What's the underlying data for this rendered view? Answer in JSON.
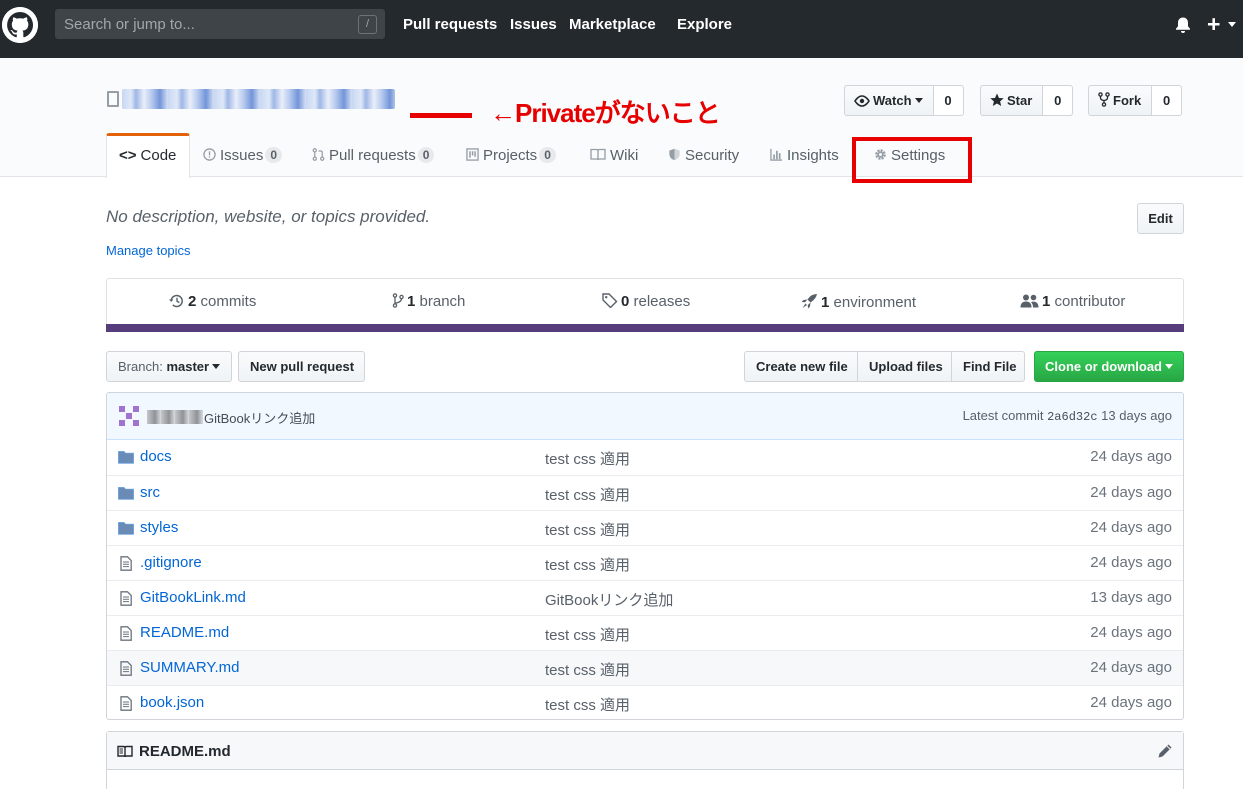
{
  "header": {
    "search_placeholder": "Search or jump to...",
    "slash_key": "/",
    "nav": [
      "Pull requests",
      "Issues",
      "Marketplace",
      "Explore"
    ],
    "plus_label": "+"
  },
  "repo": {
    "annotation": "←Privateがないこと",
    "watch_label": "Watch",
    "watch_count": "0",
    "star_label": "Star",
    "star_count": "0",
    "fork_label": "Fork",
    "fork_count": "0"
  },
  "tabs": [
    {
      "label": "Code"
    },
    {
      "label": "Issues",
      "count": "0"
    },
    {
      "label": "Pull requests",
      "count": "0"
    },
    {
      "label": "Projects",
      "count": "0"
    },
    {
      "label": "Wiki"
    },
    {
      "label": "Security"
    },
    {
      "label": "Insights"
    },
    {
      "label": "Settings"
    }
  ],
  "about": {
    "description": "No description, website, or topics provided.",
    "manage_topics": "Manage topics",
    "edit_label": "Edit"
  },
  "summary": {
    "commits_count": "2",
    "commits_label": "commits",
    "branch_count": "1",
    "branch_label": "branch",
    "releases_count": "0",
    "releases_label": "releases",
    "env_count": "1",
    "env_label": "environment",
    "contrib_count": "1",
    "contrib_label": "contributor",
    "language_color": "#563d7c"
  },
  "file_nav": {
    "branch_prefix": "Branch:",
    "branch_name": "master",
    "new_pr": "New pull request",
    "create_file": "Create new file",
    "upload_files": "Upload files",
    "find_file": "Find File",
    "clone": "Clone or download"
  },
  "commit": {
    "message": "GitBookリンク追加",
    "latest_label": "Latest commit",
    "sha": "2a6d32c",
    "age": "13 days ago"
  },
  "files": [
    {
      "name": "docs",
      "type": "folder",
      "message": "test css 適用",
      "age": "24 days ago"
    },
    {
      "name": "src",
      "type": "folder",
      "message": "test css 適用",
      "age": "24 days ago"
    },
    {
      "name": "styles",
      "type": "folder",
      "message": "test css 適用",
      "age": "24 days ago"
    },
    {
      "name": ".gitignore",
      "type": "file",
      "message": "test css 適用",
      "age": "24 days ago"
    },
    {
      "name": "GitBookLink.md",
      "type": "file",
      "message": "GitBookリンク追加",
      "age": "13 days ago"
    },
    {
      "name": "README.md",
      "type": "file",
      "message": "test css 適用",
      "age": "24 days ago"
    },
    {
      "name": "SUMMARY.md",
      "type": "file",
      "message": "test css 適用",
      "age": "24 days ago"
    },
    {
      "name": "book.json",
      "type": "file",
      "message": "test css 適用",
      "age": "24 days ago"
    }
  ],
  "readme": {
    "title": "README.md"
  },
  "colors": {
    "header_bg": "#24292e",
    "link": "#0366d6",
    "annotation_red": "#e60000",
    "clone_green": "#28a745",
    "tab_accent": "#e36209"
  }
}
